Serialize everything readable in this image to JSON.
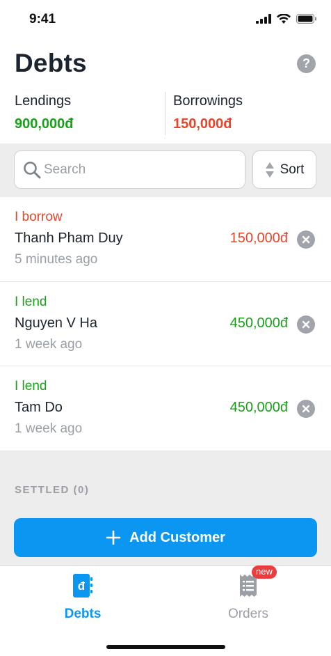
{
  "status_bar": {
    "time": "9:41"
  },
  "header": {
    "title": "Debts",
    "help_icon": "question-circle-icon",
    "help_glyph": "?"
  },
  "summary": {
    "lendings_label": "Lendings",
    "lendings_value": "900,000đ",
    "borrowings_label": "Borrowings",
    "borrowings_value": "150,000đ"
  },
  "search": {
    "placeholder": "Search",
    "value": ""
  },
  "sort": {
    "label": "Sort"
  },
  "debts": [
    {
      "type": "I borrow",
      "name": "Thanh Pham Duy",
      "time": "5 minutes ago",
      "amount": "150,000đ",
      "kind": "borrow"
    },
    {
      "type": "I lend",
      "name": "Nguyen V Ha",
      "time": "1 week ago",
      "amount": "450,000đ",
      "kind": "lend"
    },
    {
      "type": "I lend",
      "name": "Tam Do",
      "time": "1 week ago",
      "amount": "450,000đ",
      "kind": "lend"
    }
  ],
  "settled": {
    "label": "SETTLED (0)"
  },
  "add_customer": {
    "label": "Add Customer",
    "icon": "plus-icon"
  },
  "tabs": [
    {
      "label": "Debts",
      "icon": "debt-book-icon",
      "active": true,
      "icon_glyph": "đ"
    },
    {
      "label": "Orders",
      "icon": "receipt-icon",
      "active": false,
      "badge": "new"
    }
  ],
  "colors": {
    "accent": "#0b96f2",
    "lend": "#1aa11a",
    "borrow": "#e8452a",
    "muted": "#9a9fa6",
    "badge": "#ea3d3d"
  }
}
